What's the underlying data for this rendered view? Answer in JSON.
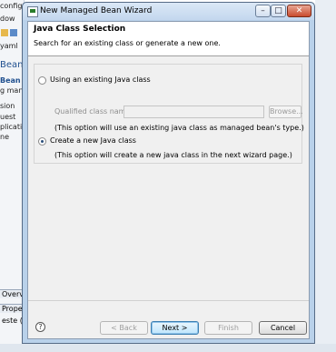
{
  "background": {
    "left_items": [
      "config.",
      "dow",
      "yaml",
      "Bean",
      "Bean El",
      "g mana",
      "sion",
      "uest",
      "plication",
      "ne"
    ],
    "bottom_tabs": [
      "Overvie",
      "Prope",
      "este (Ja"
    ]
  },
  "dialog": {
    "title": "New Managed Bean Wizard",
    "controls": {
      "minimize": "–",
      "maximize": "□",
      "close": "✕"
    },
    "banner": {
      "title": "Java Class Selection",
      "description": "Search for an existing class or generate a new one."
    },
    "options": {
      "existing": {
        "label": "Using an existing Java class",
        "checked": false,
        "qualified_label": "Qualified class name:",
        "qualified_value": "",
        "browse_label": "Browse...",
        "note": "(This option will use an existing java class as managed bean's type.)"
      },
      "create": {
        "label": "Create a new Java class",
        "checked": true,
        "note": "(This option will create a new java class in the next wizard page.)"
      }
    },
    "buttons": {
      "help": "?",
      "back": "< Back",
      "next": "Next >",
      "finish": "Finish",
      "cancel": "Cancel"
    }
  }
}
